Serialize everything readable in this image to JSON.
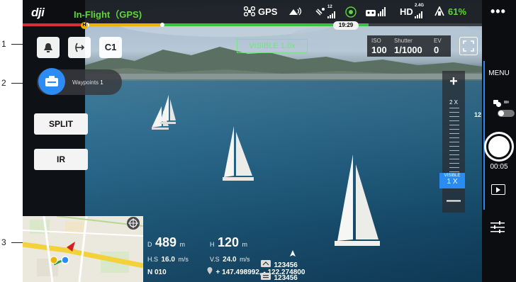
{
  "callouts": [
    "1",
    "2",
    "3"
  ],
  "topbar": {
    "logo": "dji",
    "flight_status": "In-Flight（GPS)",
    "gps_label": "GPS",
    "remote_signal": "((·))",
    "satellite_count": "12",
    "hd_label": "HD",
    "hd_band": "2.4G",
    "battery": "61%",
    "flight_time": "19:29",
    "home_marker": "H",
    "colors": {
      "status_green": "#5ed63a",
      "accent_blue": "#2c8cf4"
    }
  },
  "left_controls": {
    "auto_takeoff_icon": "bell-icon",
    "return_home_icon": "return-home-icon",
    "custom_button": "C1",
    "waypoints_label": "Waypoints",
    "waypoints_count": "1",
    "split_label": "SPLIT",
    "ir_label": "IR"
  },
  "camera": {
    "visible_label": "VISIBLE 1.0x",
    "iso_label": "ISO",
    "iso_value": "100",
    "shutter_label": "Shutter",
    "shutter_value": "1/1000",
    "ev_label": "EV",
    "ev_value": "0",
    "ae_label": "AE"
  },
  "zoom": {
    "plus": "+",
    "minus": "—",
    "level_2x": "2 X",
    "indicator_top": "VISIBLE",
    "indicator_value": "1 X"
  },
  "right_panel": {
    "more": "•••",
    "menu": "MENU",
    "photo_count": "12",
    "record_time": "00:05"
  },
  "telemetry": {
    "d_label": "D",
    "d_value": "489",
    "d_unit": "m",
    "h_label": "H",
    "h_value": "120",
    "h_unit": "m",
    "hs_label": "H.S",
    "hs_value": "16.0",
    "hs_unit": "m/s",
    "vs_label": "V.S",
    "vs_value": "24.0",
    "vs_unit": "m/s",
    "heading": "N 010",
    "coords": "+ 147.498992, - 122.274800",
    "id_1": "123456",
    "id_2": "123456"
  }
}
